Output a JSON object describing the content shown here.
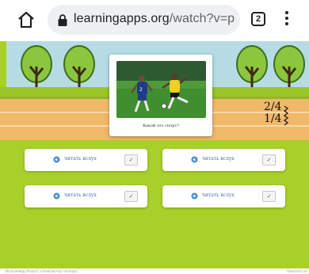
{
  "browser": {
    "url_domain": "learningapps.org",
    "url_rest": "/watch?v=p",
    "tab_count": "2",
    "home_icon": "home-icon",
    "lock_icon": "lock-icon",
    "menu_icon": "more-vert-icon"
  },
  "game": {
    "question": "Какой это спорт?",
    "fractions": [
      "2/4",
      "1/4"
    ],
    "answers": [
      {
        "label": "читать вслух",
        "check": "✓"
      },
      {
        "label": "читать вслух",
        "check": "✓"
      },
      {
        "label": "читать вслух",
        "check": "✓"
      },
      {
        "label": "читать вслух",
        "check": "✓"
      }
    ],
    "footer_left": "Игра между Player1 и Компьютер началась",
    "footer_right": "Показать на"
  },
  "colors": {
    "field": "#a8d028",
    "track": "#f1b86a",
    "sky": "#b5dce4",
    "link": "#4a6fa5"
  }
}
